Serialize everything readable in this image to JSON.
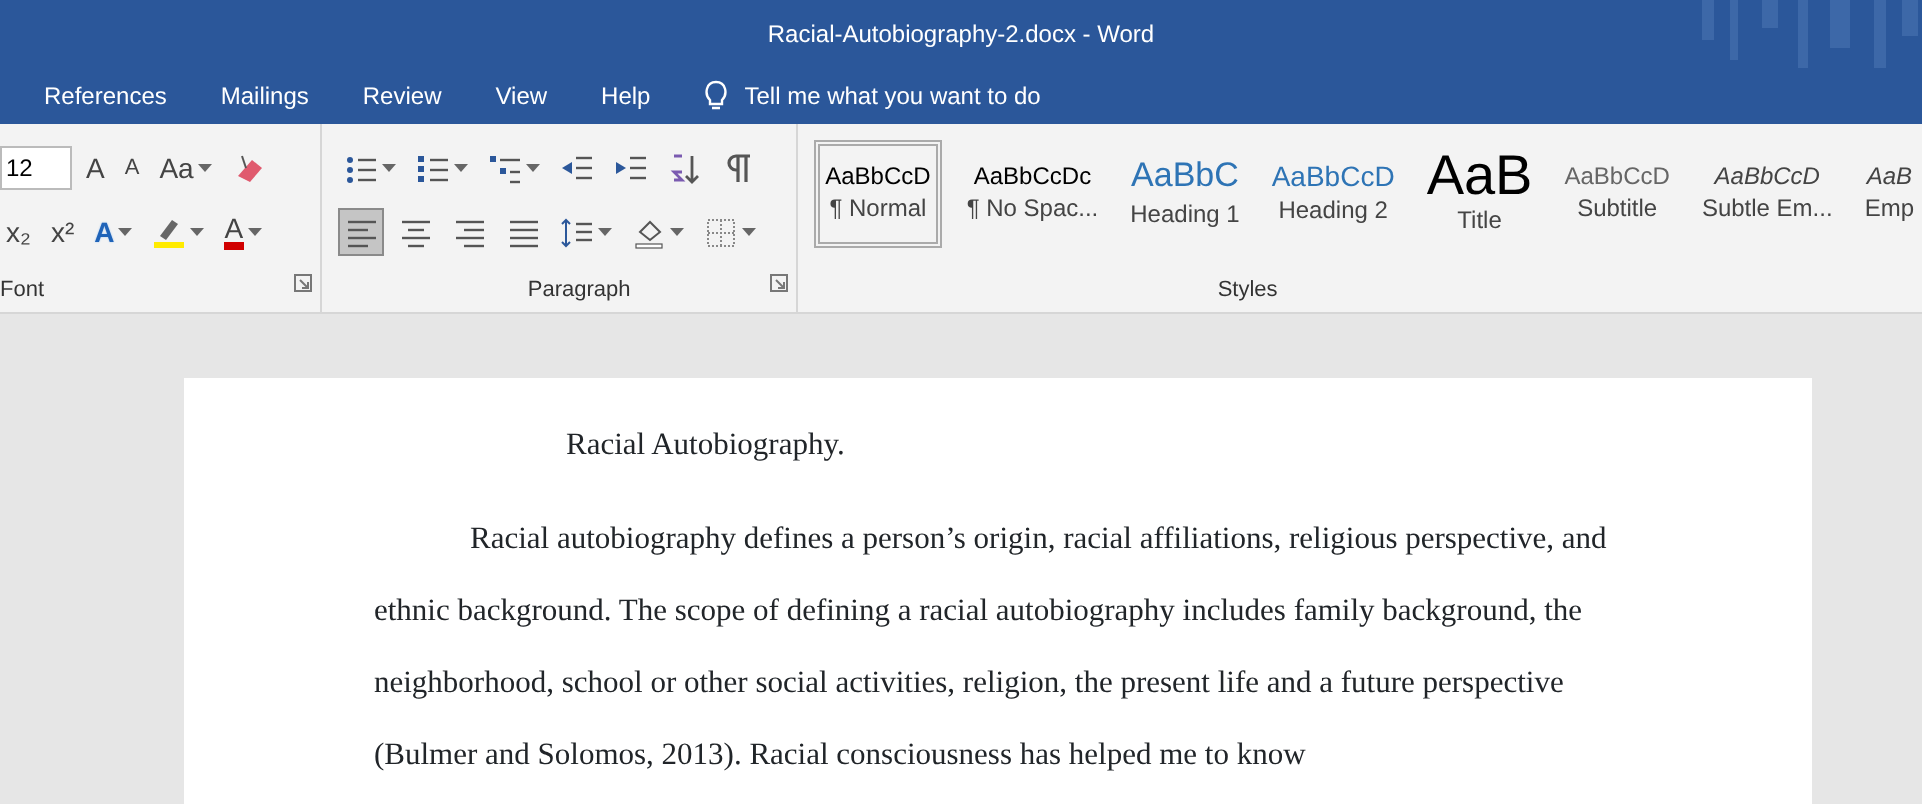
{
  "window": {
    "title": "Racial-Autobiography-2.docx  -  Word"
  },
  "tabs": [
    {
      "label": "References"
    },
    {
      "label": "Mailings"
    },
    {
      "label": "Review"
    },
    {
      "label": "View"
    },
    {
      "label": "Help"
    }
  ],
  "tell_me": {
    "placeholder": "Tell me what you want to do"
  },
  "font_group": {
    "label": "Font",
    "size": "12",
    "row1": [
      {
        "kind": "glyph",
        "glyph": "A",
        "caret": false
      },
      {
        "kind": "glyph-small",
        "glyph": "A",
        "caret": false
      },
      {
        "kind": "glyph",
        "glyph": "Aa",
        "caret": true
      },
      {
        "kind": "eraser",
        "caret": false
      }
    ],
    "row2": [
      {
        "kind": "glyph",
        "glyph": "x₂",
        "caret": false
      },
      {
        "kind": "glyph",
        "glyph": "x²",
        "caret": false
      },
      {
        "kind": "glyph-outline",
        "glyph": "A",
        "caret": true
      },
      {
        "kind": "highlight",
        "caret": true
      },
      {
        "kind": "glyph-color",
        "glyph": "A",
        "caret": true
      }
    ]
  },
  "paragraph_group": {
    "label": "Paragraph",
    "row1": [
      {
        "kind": "bullets",
        "caret": true
      },
      {
        "kind": "numbering",
        "caret": true
      },
      {
        "kind": "multilevel",
        "caret": true
      },
      {
        "kind": "outdent",
        "caret": false
      },
      {
        "kind": "indent",
        "caret": false
      },
      {
        "kind": "sort",
        "caret": false
      },
      {
        "kind": "pilcrow",
        "caret": false
      }
    ],
    "align": [
      {
        "kind": "left",
        "selected": true
      },
      {
        "kind": "center",
        "selected": false
      },
      {
        "kind": "right",
        "selected": false
      },
      {
        "kind": "justify",
        "selected": false
      }
    ],
    "row2": [
      {
        "kind": "spacing",
        "caret": true
      },
      {
        "kind": "shading",
        "caret": true
      },
      {
        "kind": "borders",
        "caret": true
      }
    ]
  },
  "styles_group": {
    "label": "Styles",
    "items": [
      {
        "preview": "AaBbCcD",
        "name": "¶ Normal",
        "kind": "normal",
        "selected": true
      },
      {
        "preview": "AaBbCcDc",
        "name": "¶ No Spac...",
        "kind": "normal",
        "selected": false
      },
      {
        "preview": "AaBbC",
        "name": "Heading 1",
        "kind": "heading1",
        "selected": false
      },
      {
        "preview": "AaBbCcD",
        "name": "Heading 2",
        "kind": "heading2",
        "selected": false
      },
      {
        "preview": "AaB",
        "name": "Title",
        "kind": "title",
        "selected": false
      },
      {
        "preview": "AaBbCcD",
        "name": "Subtitle",
        "kind": "subtitle",
        "selected": false
      },
      {
        "preview": "AaBbCcD",
        "name": "Subtle Em...",
        "kind": "emphasis",
        "selected": false
      },
      {
        "preview": "AaB",
        "name": "Emp",
        "kind": "emphasis",
        "selected": false
      }
    ]
  },
  "document": {
    "heading": "Racial Autobiography.",
    "paragraph": "Racial autobiography defines a person’s origin, racial affiliations, religious perspective, and ethnic background. The scope of defining a racial autobiography includes family background, the neighborhood, school or other social activities, religion, the present life and a future perspective (Bulmer and Solomos, 2013). Racial consciousness has helped me to know"
  }
}
